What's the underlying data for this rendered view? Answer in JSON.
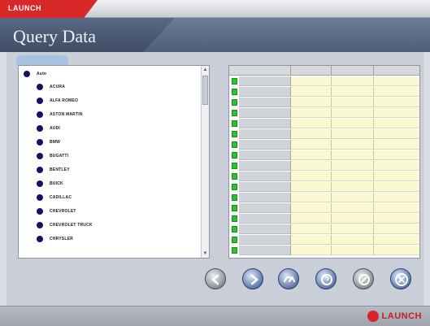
{
  "app": {
    "badge": "LAUNCH"
  },
  "header": {
    "title": "Query Data"
  },
  "tab": {
    "label": ""
  },
  "tree": {
    "root": "Auto",
    "items": [
      "ACURA",
      "ALFA ROMEO",
      "ASTON MARTIN",
      "AUDI",
      "BMW",
      "BUGATTI",
      "BENTLEY",
      "BUICK",
      "CADILLAC",
      "CHEVROLET",
      "CHEVROLET TRUCK",
      "CHRYSLER"
    ]
  },
  "grid": {
    "columns": [
      "",
      "",
      "",
      ""
    ],
    "rows": [
      "",
      "",
      "",
      "",
      "",
      "",
      "",
      "",
      "",
      "",
      "",
      "",
      "",
      "",
      "",
      "",
      ""
    ]
  },
  "buttons": [
    {
      "name": "back-button",
      "icon": "arrow-left-icon"
    },
    {
      "name": "next-button",
      "icon": "arrow-right-icon"
    },
    {
      "name": "graph-button",
      "icon": "gauge-icon"
    },
    {
      "name": "help-button",
      "icon": "help-icon"
    },
    {
      "name": "record-button",
      "icon": "record-icon"
    },
    {
      "name": "close-button",
      "icon": "close-icon"
    }
  ],
  "footer": {
    "brand": "LAUNCH"
  },
  "colors": {
    "accent": "#d9282a",
    "tree_dot": "#12125f",
    "row_indicator": "#2fbf2f",
    "cell_bg": "#fbf9d2"
  }
}
